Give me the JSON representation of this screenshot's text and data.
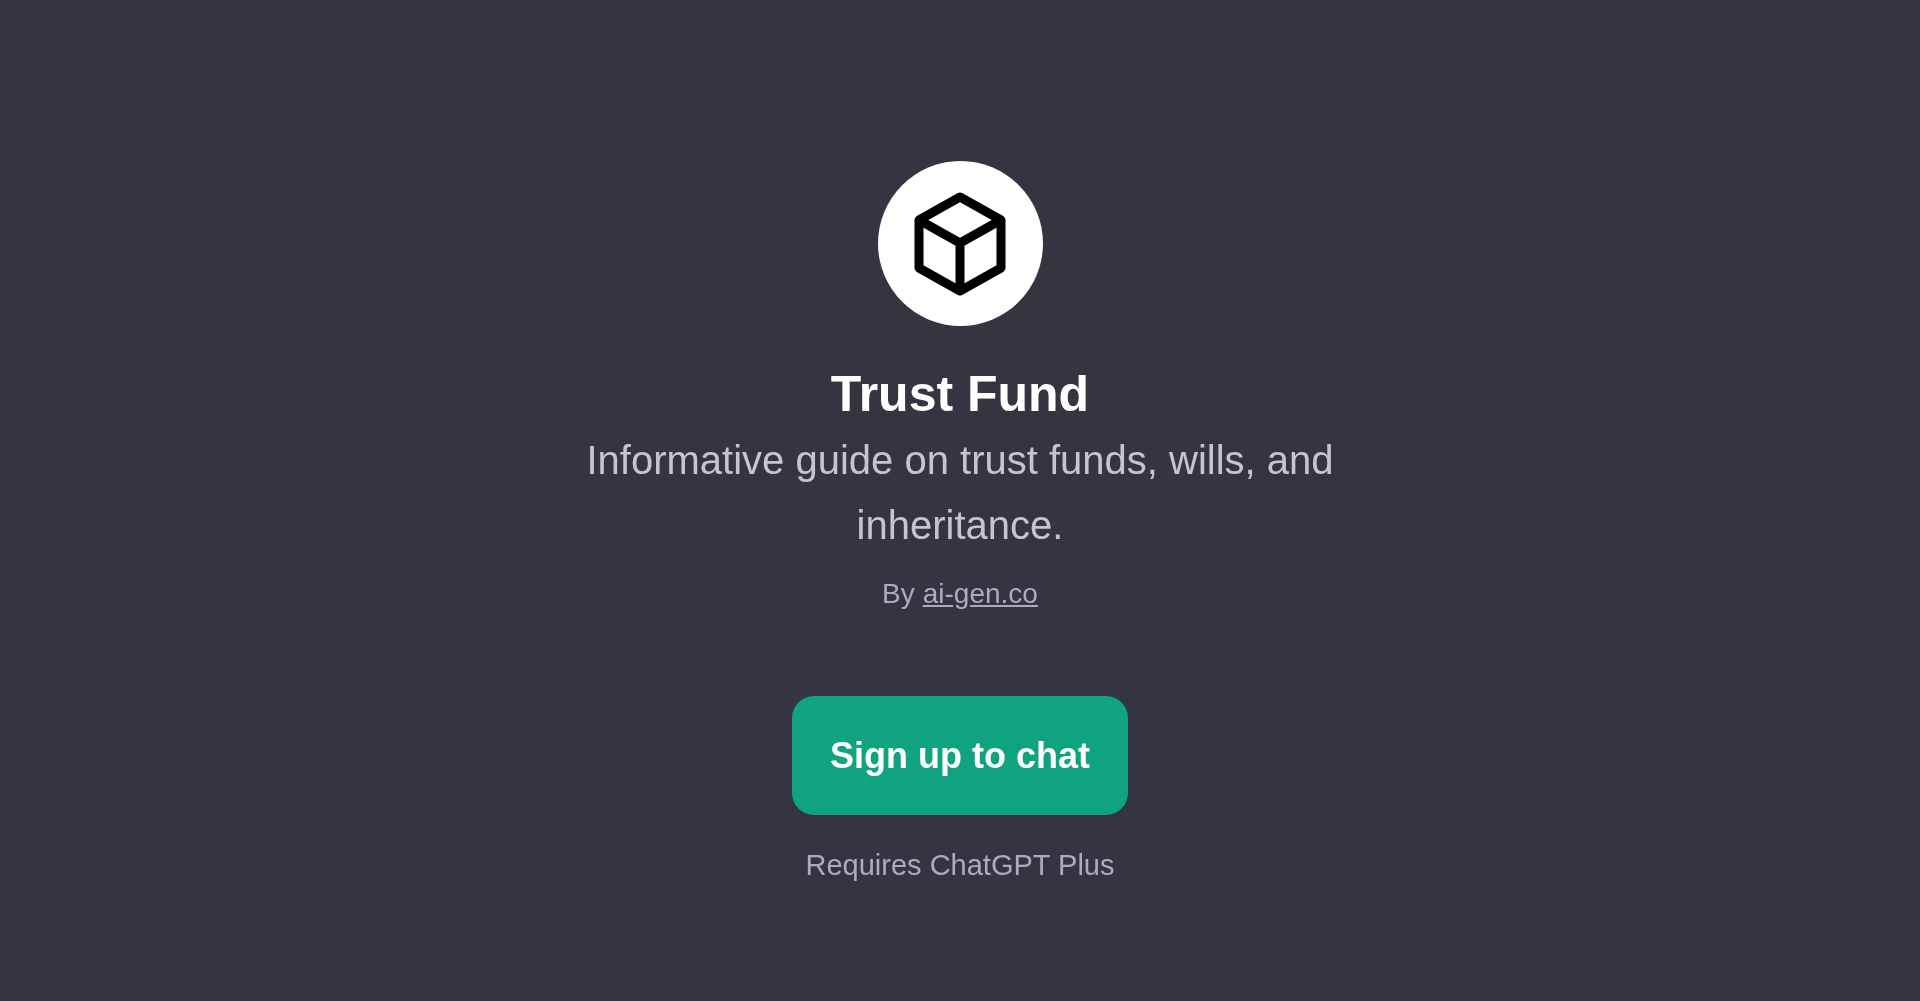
{
  "gpt": {
    "title": "Trust Fund",
    "description": "Informative guide on trust funds, wills, and inheritance.",
    "author_prefix": "By",
    "author_link": "ai-gen.co"
  },
  "signup_button": {
    "label": "Sign up to chat"
  },
  "requirement": "Requires ChatGPT Plus"
}
